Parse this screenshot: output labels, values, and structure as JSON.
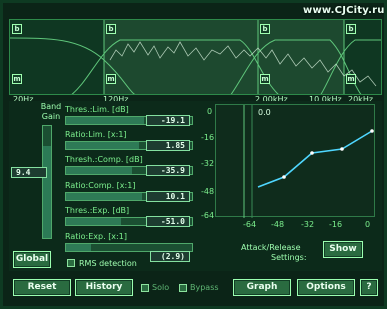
{
  "watermark": "www.CJCity.ru",
  "spectrum": {
    "freq_labels": [
      "20Hz",
      "120Hz",
      "2.00kHz",
      "10.0kHz",
      "20kHz"
    ],
    "band_markers": [
      "b",
      "b",
      "b",
      "b",
      "m",
      "m",
      "m",
      "m"
    ]
  },
  "global_gain": {
    "title": "Band\nGain",
    "value": "9.4",
    "global_label": "Global"
  },
  "controls": {
    "thres_lim_label": "Thres.:Lim. [dB]",
    "thres_lim_value": "-19.1",
    "ratio_lim_label": "Ratio:Lim. [x:1]",
    "ratio_lim_value": "1.85",
    "thres_comp_label": "Thresh.:Comp. [dB]",
    "thres_comp_value": "-35.9",
    "ratio_comp_label": "Ratio:Comp. [x:1]",
    "ratio_comp_value": "10.1",
    "thres_exp_label": "Thres.:Exp. [dB]",
    "thres_exp_value": "-51.0",
    "ratio_exp_label": "Ratio:Exp. [x:1]",
    "ratio_exp_value": "(2.9)",
    "rms_label": "RMS detection"
  },
  "graph": {
    "y_ticks": [
      "0",
      "-16",
      "-32",
      "-48",
      "-64"
    ],
    "x_ticks": [
      "-64",
      "-48",
      "-32",
      "-16",
      "0"
    ],
    "top_value": "0.0",
    "attack_release": "Attack/Release",
    "settings": "Settings:",
    "show_label": "Show"
  },
  "bottom": {
    "reset": "Reset",
    "history": "History",
    "solo": "Solo",
    "bypass": "Bypass",
    "graph": "Graph",
    "options": "Options",
    "help": "?"
  },
  "colors": {
    "accent": "#9bffb0",
    "panel_bg": "#0b2417",
    "button_bg": "#2a6b40"
  }
}
